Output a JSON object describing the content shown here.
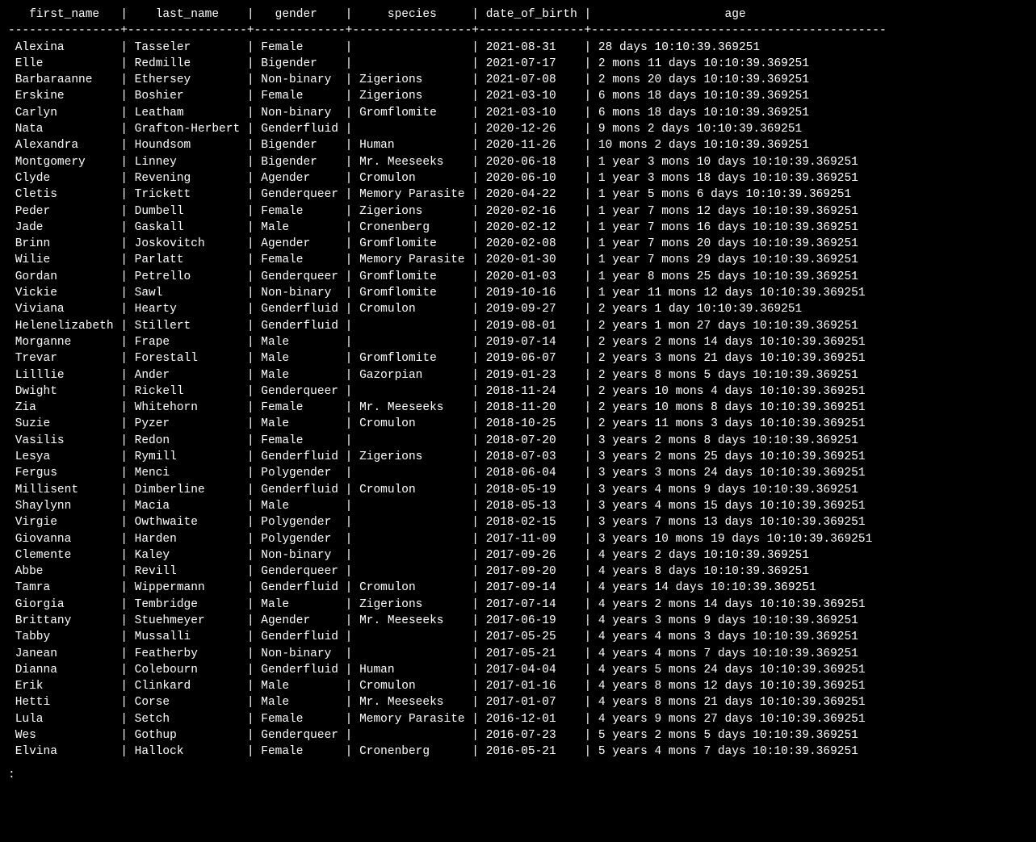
{
  "prompt": ":",
  "columns": [
    {
      "name": "first_name",
      "width": 16,
      "align": "center_header_left_data",
      "pad_left": 1
    },
    {
      "name": "last_name",
      "width": 17,
      "align": "center_header_left_data",
      "pad_left": 1
    },
    {
      "name": "gender",
      "width": 13,
      "align": "center_header_left_data",
      "pad_left": 1
    },
    {
      "name": "species",
      "width": 17,
      "align": "center_header_left_data",
      "pad_left": 1
    },
    {
      "name": "date_of_birth",
      "width": 15,
      "align": "center_header_left_data",
      "pad_left": 1
    },
    {
      "name": "age",
      "width": 42,
      "align": "center_header_left_data",
      "pad_left": 1
    }
  ],
  "rows": [
    {
      "first_name": "Alexina",
      "last_name": "Tasseler",
      "gender": "Female",
      "species": "",
      "date_of_birth": "2021-08-31",
      "age": "28 days 10:10:39.369251"
    },
    {
      "first_name": "Elle",
      "last_name": "Redmille",
      "gender": "Bigender",
      "species": "",
      "date_of_birth": "2021-07-17",
      "age": "2 mons 11 days 10:10:39.369251"
    },
    {
      "first_name": "Barbaraanne",
      "last_name": "Ethersey",
      "gender": "Non-binary",
      "species": "Zigerions",
      "date_of_birth": "2021-07-08",
      "age": "2 mons 20 days 10:10:39.369251"
    },
    {
      "first_name": "Erskine",
      "last_name": "Boshier",
      "gender": "Female",
      "species": "Zigerions",
      "date_of_birth": "2021-03-10",
      "age": "6 mons 18 days 10:10:39.369251"
    },
    {
      "first_name": "Carlyn",
      "last_name": "Leatham",
      "gender": "Non-binary",
      "species": "Gromflomite",
      "date_of_birth": "2021-03-10",
      "age": "6 mons 18 days 10:10:39.369251"
    },
    {
      "first_name": "Nata",
      "last_name": "Grafton-Herbert",
      "gender": "Genderfluid",
      "species": "",
      "date_of_birth": "2020-12-26",
      "age": "9 mons 2 days 10:10:39.369251"
    },
    {
      "first_name": "Alexandra",
      "last_name": "Houndsom",
      "gender": "Bigender",
      "species": "Human",
      "date_of_birth": "2020-11-26",
      "age": "10 mons 2 days 10:10:39.369251"
    },
    {
      "first_name": "Montgomery",
      "last_name": "Linney",
      "gender": "Bigender",
      "species": "Mr. Meeseeks",
      "date_of_birth": "2020-06-18",
      "age": "1 year 3 mons 10 days 10:10:39.369251"
    },
    {
      "first_name": "Clyde",
      "last_name": "Revening",
      "gender": "Agender",
      "species": "Cromulon",
      "date_of_birth": "2020-06-10",
      "age": "1 year 3 mons 18 days 10:10:39.369251"
    },
    {
      "first_name": "Cletis",
      "last_name": "Trickett",
      "gender": "Genderqueer",
      "species": "Memory Parasite",
      "date_of_birth": "2020-04-22",
      "age": "1 year 5 mons 6 days 10:10:39.369251"
    },
    {
      "first_name": "Peder",
      "last_name": "Dumbell",
      "gender": "Female",
      "species": "Zigerions",
      "date_of_birth": "2020-02-16",
      "age": "1 year 7 mons 12 days 10:10:39.369251"
    },
    {
      "first_name": "Jade",
      "last_name": "Gaskall",
      "gender": "Male",
      "species": "Cronenberg",
      "date_of_birth": "2020-02-12",
      "age": "1 year 7 mons 16 days 10:10:39.369251"
    },
    {
      "first_name": "Brinn",
      "last_name": "Joskovitch",
      "gender": "Agender",
      "species": "Gromflomite",
      "date_of_birth": "2020-02-08",
      "age": "1 year 7 mons 20 days 10:10:39.369251"
    },
    {
      "first_name": "Wilie",
      "last_name": "Parlatt",
      "gender": "Female",
      "species": "Memory Parasite",
      "date_of_birth": "2020-01-30",
      "age": "1 year 7 mons 29 days 10:10:39.369251"
    },
    {
      "first_name": "Gordan",
      "last_name": "Petrello",
      "gender": "Genderqueer",
      "species": "Gromflomite",
      "date_of_birth": "2020-01-03",
      "age": "1 year 8 mons 25 days 10:10:39.369251"
    },
    {
      "first_name": "Vickie",
      "last_name": "Sawl",
      "gender": "Non-binary",
      "species": "Gromflomite",
      "date_of_birth": "2019-10-16",
      "age": "1 year 11 mons 12 days 10:10:39.369251"
    },
    {
      "first_name": "Viviana",
      "last_name": "Hearty",
      "gender": "Genderfluid",
      "species": "Cromulon",
      "date_of_birth": "2019-09-27",
      "age": "2 years 1 day 10:10:39.369251"
    },
    {
      "first_name": "Helenelizabeth",
      "last_name": "Stillert",
      "gender": "Genderfluid",
      "species": "",
      "date_of_birth": "2019-08-01",
      "age": "2 years 1 mon 27 days 10:10:39.369251"
    },
    {
      "first_name": "Morganne",
      "last_name": "Frape",
      "gender": "Male",
      "species": "",
      "date_of_birth": "2019-07-14",
      "age": "2 years 2 mons 14 days 10:10:39.369251"
    },
    {
      "first_name": "Trevar",
      "last_name": "Forestall",
      "gender": "Male",
      "species": "Gromflomite",
      "date_of_birth": "2019-06-07",
      "age": "2 years 3 mons 21 days 10:10:39.369251"
    },
    {
      "first_name": "Lilllie",
      "last_name": "Ander",
      "gender": "Male",
      "species": "Gazorpian",
      "date_of_birth": "2019-01-23",
      "age": "2 years 8 mons 5 days 10:10:39.369251"
    },
    {
      "first_name": "Dwight",
      "last_name": "Rickell",
      "gender": "Genderqueer",
      "species": "",
      "date_of_birth": "2018-11-24",
      "age": "2 years 10 mons 4 days 10:10:39.369251"
    },
    {
      "first_name": "Zia",
      "last_name": "Whitehorn",
      "gender": "Female",
      "species": "Mr. Meeseeks",
      "date_of_birth": "2018-11-20",
      "age": "2 years 10 mons 8 days 10:10:39.369251"
    },
    {
      "first_name": "Suzie",
      "last_name": "Pyzer",
      "gender": "Male",
      "species": "Cromulon",
      "date_of_birth": "2018-10-25",
      "age": "2 years 11 mons 3 days 10:10:39.369251"
    },
    {
      "first_name": "Vasilis",
      "last_name": "Redon",
      "gender": "Female",
      "species": "",
      "date_of_birth": "2018-07-20",
      "age": "3 years 2 mons 8 days 10:10:39.369251"
    },
    {
      "first_name": "Lesya",
      "last_name": "Rymill",
      "gender": "Genderfluid",
      "species": "Zigerions",
      "date_of_birth": "2018-07-03",
      "age": "3 years 2 mons 25 days 10:10:39.369251"
    },
    {
      "first_name": "Fergus",
      "last_name": "Menci",
      "gender": "Polygender",
      "species": "",
      "date_of_birth": "2018-06-04",
      "age": "3 years 3 mons 24 days 10:10:39.369251"
    },
    {
      "first_name": "Millisent",
      "last_name": "Dimberline",
      "gender": "Genderfluid",
      "species": "Cromulon",
      "date_of_birth": "2018-05-19",
      "age": "3 years 4 mons 9 days 10:10:39.369251"
    },
    {
      "first_name": "Shaylynn",
      "last_name": "Macia",
      "gender": "Male",
      "species": "",
      "date_of_birth": "2018-05-13",
      "age": "3 years 4 mons 15 days 10:10:39.369251"
    },
    {
      "first_name": "Virgie",
      "last_name": "Owthwaite",
      "gender": "Polygender",
      "species": "",
      "date_of_birth": "2018-02-15",
      "age": "3 years 7 mons 13 days 10:10:39.369251"
    },
    {
      "first_name": "Giovanna",
      "last_name": "Harden",
      "gender": "Polygender",
      "species": "",
      "date_of_birth": "2017-11-09",
      "age": "3 years 10 mons 19 days 10:10:39.369251"
    },
    {
      "first_name": "Clemente",
      "last_name": "Kaley",
      "gender": "Non-binary",
      "species": "",
      "date_of_birth": "2017-09-26",
      "age": "4 years 2 days 10:10:39.369251"
    },
    {
      "first_name": "Abbe",
      "last_name": "Revill",
      "gender": "Genderqueer",
      "species": "",
      "date_of_birth": "2017-09-20",
      "age": "4 years 8 days 10:10:39.369251"
    },
    {
      "first_name": "Tamra",
      "last_name": "Wippermann",
      "gender": "Genderfluid",
      "species": "Cromulon",
      "date_of_birth": "2017-09-14",
      "age": "4 years 14 days 10:10:39.369251"
    },
    {
      "first_name": "Giorgia",
      "last_name": "Tembridge",
      "gender": "Male",
      "species": "Zigerions",
      "date_of_birth": "2017-07-14",
      "age": "4 years 2 mons 14 days 10:10:39.369251"
    },
    {
      "first_name": "Brittany",
      "last_name": "Stuehmeyer",
      "gender": "Agender",
      "species": "Mr. Meeseeks",
      "date_of_birth": "2017-06-19",
      "age": "4 years 3 mons 9 days 10:10:39.369251"
    },
    {
      "first_name": "Tabby",
      "last_name": "Mussalli",
      "gender": "Genderfluid",
      "species": "",
      "date_of_birth": "2017-05-25",
      "age": "4 years 4 mons 3 days 10:10:39.369251"
    },
    {
      "first_name": "Janean",
      "last_name": "Featherby",
      "gender": "Non-binary",
      "species": "",
      "date_of_birth": "2017-05-21",
      "age": "4 years 4 mons 7 days 10:10:39.369251"
    },
    {
      "first_name": "Dianna",
      "last_name": "Colebourn",
      "gender": "Genderfluid",
      "species": "Human",
      "date_of_birth": "2017-04-04",
      "age": "4 years 5 mons 24 days 10:10:39.369251"
    },
    {
      "first_name": "Erik",
      "last_name": "Clinkard",
      "gender": "Male",
      "species": "Cromulon",
      "date_of_birth": "2017-01-16",
      "age": "4 years 8 mons 12 days 10:10:39.369251"
    },
    {
      "first_name": "Hetti",
      "last_name": "Corse",
      "gender": "Male",
      "species": "Mr. Meeseeks",
      "date_of_birth": "2017-01-07",
      "age": "4 years 8 mons 21 days 10:10:39.369251"
    },
    {
      "first_name": "Lula",
      "last_name": "Setch",
      "gender": "Female",
      "species": "Memory Parasite",
      "date_of_birth": "2016-12-01",
      "age": "4 years 9 mons 27 days 10:10:39.369251"
    },
    {
      "first_name": "Wes",
      "last_name": "Gothup",
      "gender": "Genderqueer",
      "species": "",
      "date_of_birth": "2016-07-23",
      "age": "5 years 2 mons 5 days 10:10:39.369251"
    },
    {
      "first_name": "Elvina",
      "last_name": "Hallock",
      "gender": "Female",
      "species": "Cronenberg",
      "date_of_birth": "2016-05-21",
      "age": "5 years 4 mons 7 days 10:10:39.369251"
    }
  ]
}
